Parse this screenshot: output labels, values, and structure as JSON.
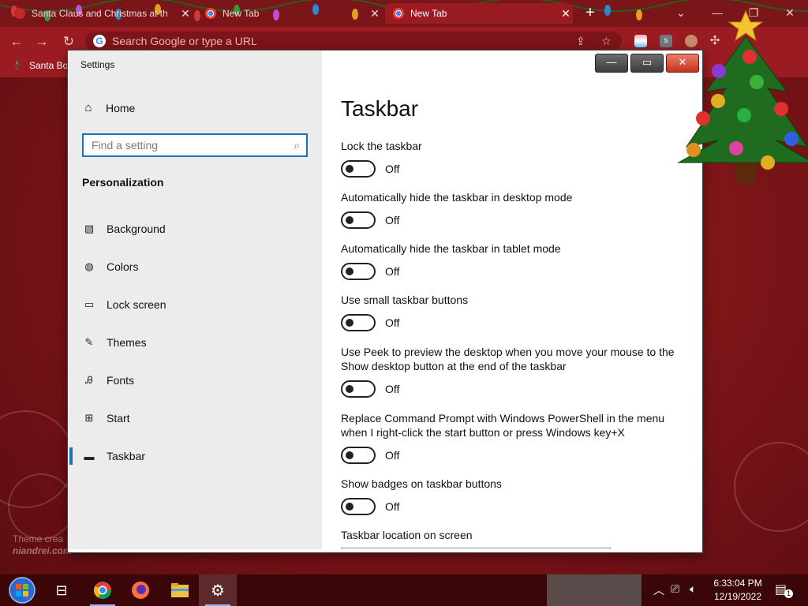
{
  "browser": {
    "tabs": [
      {
        "label": "Santa Claus and Christmas at th",
        "close": "✕"
      },
      {
        "label": "New Tab",
        "close": "✕"
      },
      {
        "label": "New Tab",
        "close": "✕"
      }
    ],
    "new_tab": "+",
    "omnibox_placeholder": "Search Google or type a URL",
    "bookmark": "Santa Bo",
    "window_controls": {
      "dropdown": "⌄",
      "minimize": "—",
      "restore": "❐",
      "close": "✕"
    },
    "nav": {
      "back": "←",
      "forward": "→",
      "reload": "↻"
    }
  },
  "settings_window": {
    "title": "Settings",
    "caption": {
      "minimize": "—",
      "maximize": "▭",
      "close": "✕"
    },
    "home_label": "Home",
    "search_placeholder": "Find a setting",
    "section": "Personalization",
    "nav": [
      {
        "label": "Background",
        "icon": "picture-icon"
      },
      {
        "label": "Colors",
        "icon": "palette-icon"
      },
      {
        "label": "Lock screen",
        "icon": "lock-screen-icon"
      },
      {
        "label": "Themes",
        "icon": "brush-icon"
      },
      {
        "label": "Fonts",
        "icon": "font-icon"
      },
      {
        "label": "Start",
        "icon": "start-grid-icon"
      },
      {
        "label": "Taskbar",
        "icon": "taskbar-icon",
        "selected": true
      }
    ],
    "page_title": "Taskbar",
    "settings": [
      {
        "label": "Lock the taskbar",
        "state": "Off"
      },
      {
        "label": "Automatically hide the taskbar in desktop mode",
        "state": "Off"
      },
      {
        "label": "Automatically hide the taskbar in tablet mode",
        "state": "Off"
      },
      {
        "label": "Use small taskbar buttons",
        "state": "Off"
      },
      {
        "label": "Use Peek to preview the desktop when you move your mouse to the Show desktop button at the end of the taskbar",
        "state": "Off"
      },
      {
        "label": "Replace Command Prompt with Windows PowerShell in the menu when I right-click the start button or press Windows key+X",
        "state": "Off"
      },
      {
        "label": "Show badges on taskbar buttons",
        "state": "Off"
      }
    ],
    "location_label": "Taskbar location on screen"
  },
  "desktop": {
    "credit_line1": "Theme crea",
    "credit_line2": "niandrei.com"
  },
  "taskbar": {
    "time": "6:33:04 PM",
    "date": "12/19/2022",
    "notification_count": "1"
  },
  "colors": {
    "accent": "#1a73b8",
    "desktop": "#8a1a1e",
    "toggle": "#222222"
  }
}
